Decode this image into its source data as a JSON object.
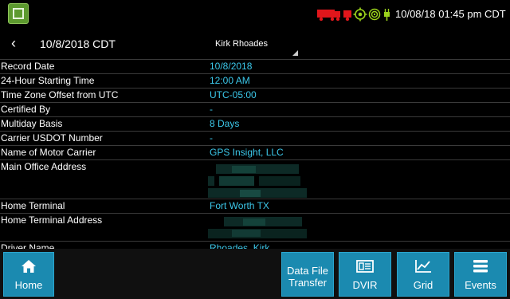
{
  "status_bar": {
    "datetime": "10/08/18 01:45 pm CDT",
    "icons": [
      "app-icon",
      "truck-icon",
      "gps-icon",
      "signal-icon",
      "plug-icon"
    ]
  },
  "header": {
    "back_icon": "‹",
    "date": "10/8/2018 CDT",
    "driver": "Kirk Rhoades"
  },
  "records": [
    {
      "label": "Record Date",
      "value": "10/8/2018"
    },
    {
      "label": "24-Hour Starting Time",
      "value": "12:00 AM"
    },
    {
      "label": "Time Zone Offset from UTC",
      "value": "UTC-05:00"
    },
    {
      "label": "Certified By",
      "value": "-"
    },
    {
      "label": "Multiday Basis",
      "value": "8 Days"
    },
    {
      "label": "Carrier USDOT Number",
      "value": "-"
    },
    {
      "label": "Name of Motor Carrier",
      "value": "GPS Insight, LLC"
    },
    {
      "label": "Main Office Address",
      "value": ""
    },
    {
      "label": "Home Terminal",
      "value": "Fort Worth TX"
    },
    {
      "label": "Home Terminal Address",
      "value": ""
    },
    {
      "label": "Driver Name",
      "value": "Rhoades, Kirk"
    }
  ],
  "buttons": {
    "home": "Home",
    "data_file_line1": "Data File",
    "data_file_line2": "Transfer",
    "dvir": "DVIR",
    "grid": "Grid",
    "events": "Events"
  },
  "colors": {
    "accent": "#3cc8ea",
    "button": "#1b8ab0",
    "status_red": "#e0161b",
    "status_green": "#9bd21c"
  }
}
